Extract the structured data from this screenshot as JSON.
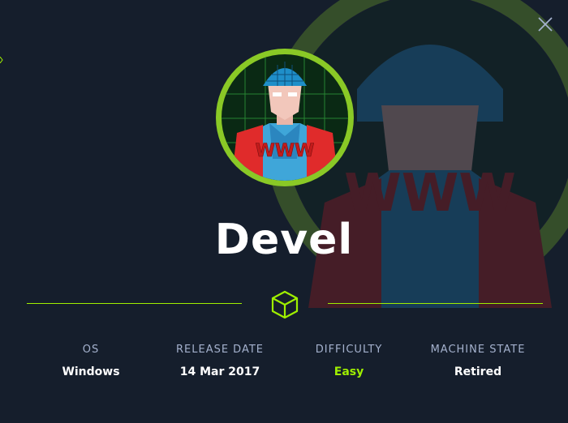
{
  "machine": {
    "name": "Devel",
    "avatar_name": "www-hacker-avatar"
  },
  "stats": [
    {
      "label": "OS",
      "value": "Windows"
    },
    {
      "label": "RELEASE DATE",
      "value": "14 Mar 2017"
    },
    {
      "label": "DIFFICULTY",
      "value": "Easy"
    },
    {
      "label": "MACHINE STATE",
      "value": "Retired"
    }
  ],
  "avatar_text": "WWW",
  "colors": {
    "background": "#151e2c",
    "accent": "#9fef00",
    "label": "#a4b1cd",
    "ring": "#8ac926"
  },
  "icons": {
    "close": "close-icon",
    "divider_center": "cube-icon"
  }
}
